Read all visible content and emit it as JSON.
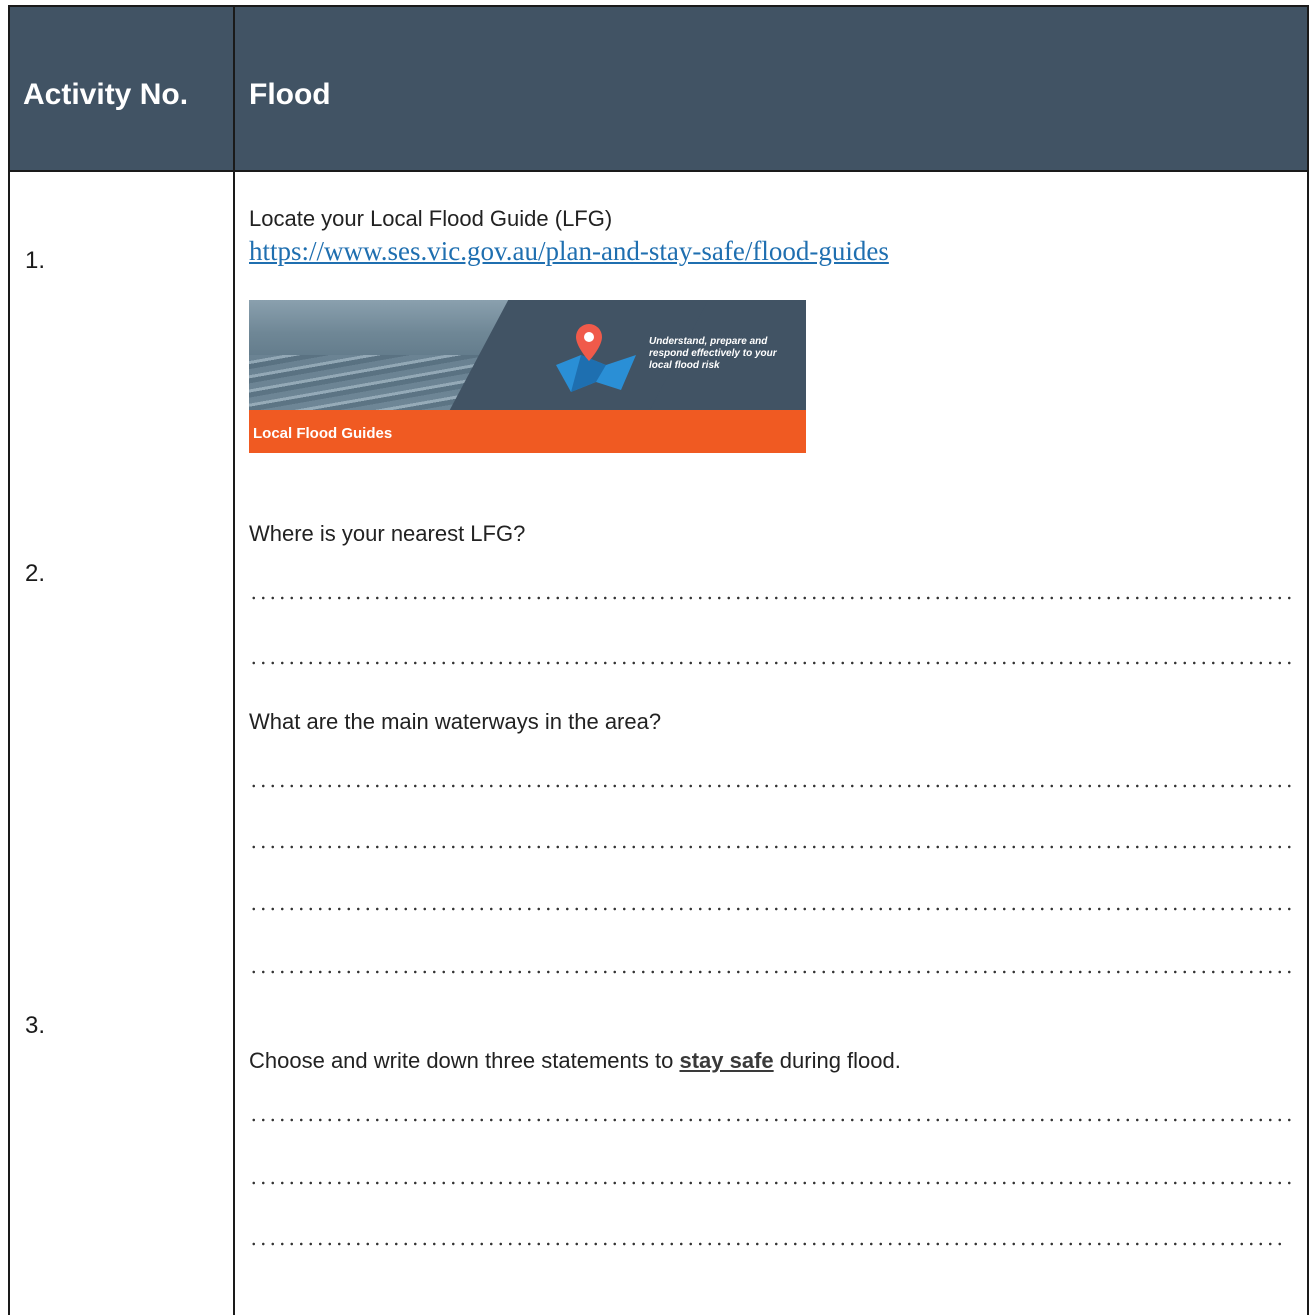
{
  "header": {
    "col1": "Activity No.",
    "col2": "Flood"
  },
  "rows": {
    "n1": "1.",
    "n2": "2.",
    "n3": "3."
  },
  "activity1": {
    "instruction": "Locate your Local Flood Guide (LFG)",
    "link": "https://www.ses.vic.gov.au/plan-and-stay-safe/flood-guides",
    "banner_tagline": "Understand, prepare and respond effectively to your local flood risk",
    "banner_title": "Local Flood Guides"
  },
  "activity2": {
    "q1": "Where is your nearest LFG?",
    "q2": "What are the main waterways in the area?"
  },
  "activity3": {
    "prefix": "Choose and write down three statements to ",
    "emphasis": "stay safe",
    "suffix": " during flood."
  },
  "colors": {
    "header_bg": "#415364",
    "link": "#1f6fb0",
    "banner_orange": "#f05a22"
  }
}
